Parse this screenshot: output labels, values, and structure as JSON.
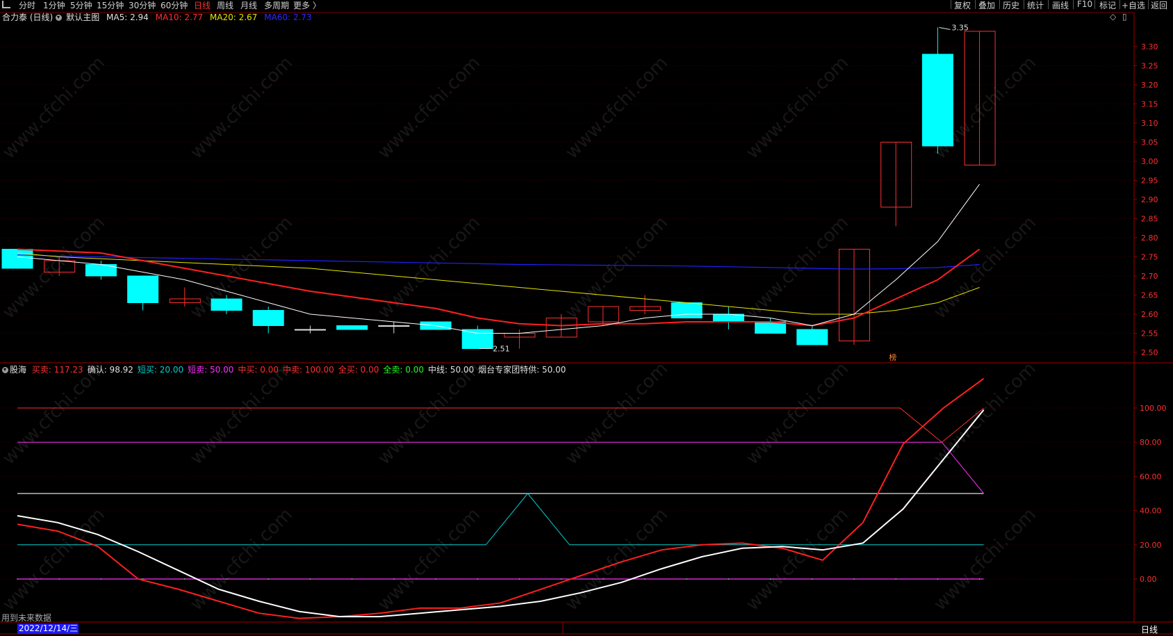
{
  "top_bar": {
    "periods": [
      "分时",
      "1分钟",
      "5分钟",
      "15分钟",
      "30分钟",
      "60分钟",
      "日线",
      "周线",
      "月线",
      "多周期",
      "更多 〉"
    ],
    "active": "日线",
    "right_tools": [
      "复权",
      "叠加",
      "历史",
      "统计",
      "画线",
      "F10",
      "标记",
      "+自选",
      "返回"
    ]
  },
  "main_chart": {
    "stock_name": "合力泰 (日线)",
    "template": "默认主图",
    "ma5": "MA5: 2.94",
    "ma10": "MA10: 2.77",
    "ma20": "MA20: 2.67",
    "ma60": "MA60: 2.73",
    "high_label": "3.35",
    "low_label": "2.51",
    "bang_label": "榜",
    "y_ticks": [
      "3.30",
      "3.25",
      "3.20",
      "3.15",
      "3.10",
      "3.05",
      "3.00",
      "2.95",
      "2.90",
      "2.85",
      "2.80",
      "2.75",
      "2.70",
      "2.65",
      "2.60",
      "2.55",
      "2.50"
    ],
    "colors": {
      "up": "#ff3030",
      "down": "#00ffff",
      "ma5": "#ffffff",
      "ma10": "#ff2020",
      "ma20": "#e8e800",
      "ma60": "#2020ff"
    }
  },
  "indicator": {
    "name": "股海",
    "fields": [
      {
        "text": "买卖: 117.23",
        "color": "#ff3030"
      },
      {
        "text": "确认: 98.92",
        "color": "#e0e0e0"
      },
      {
        "text": "短买: 20.00",
        "color": "#00d0d0"
      },
      {
        "text": "短卖: 50.00",
        "color": "#ff30ff"
      },
      {
        "text": "中买: 0.00",
        "color": "#ff3030"
      },
      {
        "text": "中卖: 100.00",
        "color": "#ff3030"
      },
      {
        "text": "全买: 0.00",
        "color": "#ff3030"
      },
      {
        "text": "全卖: 0.00",
        "color": "#20ff20"
      },
      {
        "text": "中线: 50.00",
        "color": "#e0e0e0"
      },
      {
        "text": "烟台专家团特供: 50.00",
        "color": "#e0e0e0"
      }
    ],
    "y_ticks": [
      "100.00",
      "80.00",
      "60.00",
      "40.00",
      "20.00",
      "0.00"
    ]
  },
  "footer": {
    "future_note": "用到未来数据",
    "date": "2022/12/14/三",
    "period": "日线"
  },
  "watermark": "www.cfchi.com",
  "chart_data": {
    "type": "candlestick",
    "candles": [
      {
        "o": 2.77,
        "c": 2.72,
        "h": 2.77,
        "l": 2.72
      },
      {
        "o": 2.71,
        "c": 2.74,
        "h": 2.75,
        "l": 2.7
      },
      {
        "o": 2.73,
        "c": 2.7,
        "h": 2.74,
        "l": 2.69
      },
      {
        "o": 2.7,
        "c": 2.63,
        "h": 2.7,
        "l": 2.61
      },
      {
        "o": 2.63,
        "c": 2.64,
        "h": 2.67,
        "l": 2.62
      },
      {
        "o": 2.64,
        "c": 2.61,
        "h": 2.65,
        "l": 2.6
      },
      {
        "o": 2.61,
        "c": 2.57,
        "h": 2.62,
        "l": 2.55
      },
      {
        "o": 2.56,
        "c": 2.56,
        "h": 2.57,
        "l": 2.55
      },
      {
        "o": 2.57,
        "c": 2.56,
        "h": 2.57,
        "l": 2.56
      },
      {
        "o": 2.57,
        "c": 2.57,
        "h": 2.58,
        "l": 2.55
      },
      {
        "o": 2.58,
        "c": 2.56,
        "h": 2.58,
        "l": 2.56
      },
      {
        "o": 2.56,
        "c": 2.51,
        "h": 2.57,
        "l": 2.51
      },
      {
        "o": 2.54,
        "c": 2.55,
        "h": 2.56,
        "l": 2.51
      },
      {
        "o": 2.54,
        "c": 2.59,
        "h": 2.6,
        "l": 2.54
      },
      {
        "o": 2.58,
        "c": 2.62,
        "h": 2.62,
        "l": 2.57
      },
      {
        "o": 2.61,
        "c": 2.62,
        "h": 2.65,
        "l": 2.6
      },
      {
        "o": 2.63,
        "c": 2.59,
        "h": 2.63,
        "l": 2.59
      },
      {
        "o": 2.6,
        "c": 2.58,
        "h": 2.62,
        "l": 2.56
      },
      {
        "o": 2.58,
        "c": 2.55,
        "h": 2.59,
        "l": 2.55
      },
      {
        "o": 2.56,
        "c": 2.52,
        "h": 2.57,
        "l": 2.52
      },
      {
        "o": 2.53,
        "c": 2.77,
        "h": 2.77,
        "l": 2.52
      },
      {
        "o": 2.88,
        "c": 3.05,
        "h": 3.05,
        "l": 2.83
      },
      {
        "o": 3.28,
        "c": 3.04,
        "h": 3.35,
        "l": 3.02
      },
      {
        "o": 2.99,
        "c": 3.34,
        "h": 3.34,
        "l": 2.99
      }
    ],
    "ma5": [
      2.75,
      2.74,
      2.73,
      2.71,
      2.69,
      2.66,
      2.63,
      2.6,
      2.59,
      2.58,
      2.57,
      2.55,
      2.55,
      2.56,
      2.57,
      2.59,
      2.6,
      2.6,
      2.59,
      2.57,
      2.6,
      2.69,
      2.79,
      2.94
    ],
    "ma10": [
      2.77,
      2.765,
      2.76,
      2.74,
      2.72,
      2.7,
      2.68,
      2.66,
      2.645,
      2.63,
      2.615,
      2.59,
      2.575,
      2.57,
      2.575,
      2.575,
      2.58,
      2.58,
      2.58,
      2.57,
      2.59,
      2.64,
      2.69,
      2.77
    ],
    "ma20": [
      2.76,
      2.75,
      2.745,
      2.74,
      2.735,
      2.73,
      2.725,
      2.72,
      2.71,
      2.7,
      2.69,
      2.68,
      2.67,
      2.66,
      2.65,
      2.64,
      2.63,
      2.62,
      2.61,
      2.6,
      2.6,
      2.61,
      2.63,
      2.67
    ],
    "ma60": [
      2.755,
      2.752,
      2.75,
      2.748,
      2.746,
      2.744,
      2.742,
      2.74,
      2.738,
      2.736,
      2.734,
      2.732,
      2.73,
      2.729,
      2.728,
      2.727,
      2.726,
      2.724,
      2.722,
      2.72,
      2.718,
      2.719,
      2.722,
      2.73
    ],
    "indicator_series": {
      "买卖": [
        32,
        28,
        19,
        0,
        -6,
        -13,
        -20,
        -23,
        -22,
        -20,
        -17,
        -17,
        -14,
        -6,
        2,
        10,
        17,
        20,
        21,
        18,
        11,
        33,
        79,
        100,
        117.23
      ],
      "确认": [
        37,
        33,
        26,
        16,
        5,
        -6,
        -13,
        -19,
        -22,
        -22,
        -20,
        -18,
        -16,
        -13,
        -8,
        -2,
        6,
        13,
        18,
        19,
        17,
        21,
        41,
        70,
        98.92
      ],
      "短买": [
        20,
        20,
        20,
        20,
        20,
        20,
        20,
        20,
        20,
        20,
        20,
        20,
        50,
        20,
        20,
        20,
        20,
        20,
        20,
        20,
        20,
        20,
        20,
        20,
        20
      ],
      "短卖": [
        80,
        80,
        80,
        80,
        80,
        80,
        80,
        80,
        80,
        80,
        80,
        80,
        80,
        80,
        80,
        80,
        80,
        80,
        80,
        80,
        80,
        80,
        80,
        80,
        50
      ],
      "中卖": [
        100,
        100,
        100,
        100,
        100,
        100,
        100,
        100,
        100,
        100,
        100,
        100,
        100,
        100,
        100,
        100,
        100,
        100,
        100,
        100,
        100,
        100,
        100,
        80,
        100
      ],
      "中线": 50
    }
  }
}
